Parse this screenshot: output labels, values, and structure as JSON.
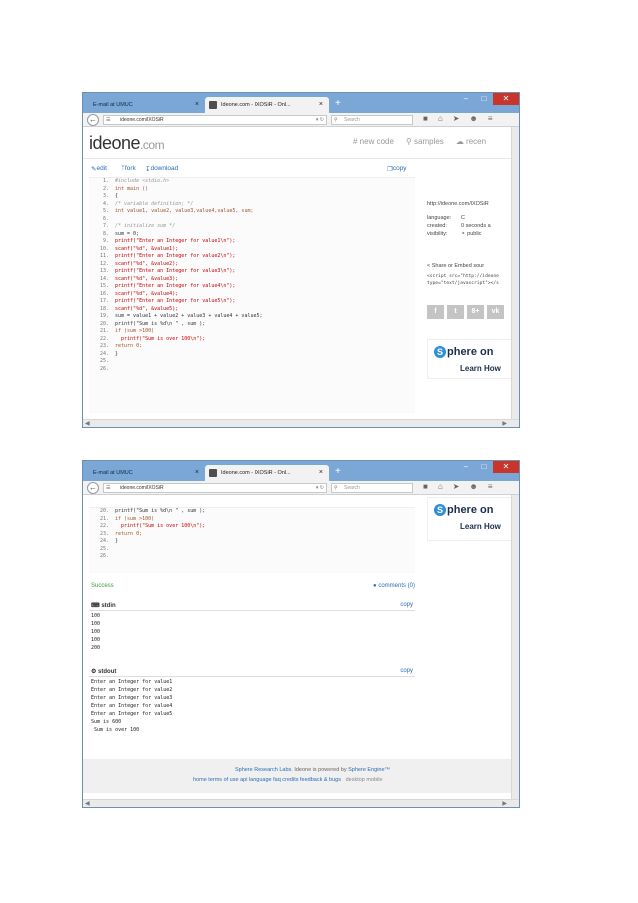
{
  "browser": {
    "tab_inactive": "E-mail at UMUC",
    "tab_active": "Ideone.com - lXOSiR - Onl...",
    "tab_close": "×",
    "new_tab": "+",
    "url": "ideone.com/lXOSiR",
    "search_placeholder": "Search",
    "min": "–",
    "max": "□",
    "close": "✕"
  },
  "ideone": {
    "logo_main": "ideone",
    "logo_com": ".com",
    "nav_new_code": "new code",
    "nav_samples": "samples",
    "nav_recent": "recen",
    "edit": "edit",
    "fork": "fork",
    "download": "download",
    "copy": "copy"
  },
  "code_full": [
    {
      "n": "1.",
      "t": "#include <stdio.h>",
      "c": "cm"
    },
    {
      "n": "2.",
      "t": "int main ()",
      "c": "kw"
    },
    {
      "n": "3.",
      "t": "{",
      "c": "pl"
    },
    {
      "n": "4.",
      "t": "/* variable definition; */",
      "c": "cm"
    },
    {
      "n": "5.",
      "t": "int value1, value2, value3,value4,value5, sum;",
      "c": "kw"
    },
    {
      "n": "6.",
      "t": "",
      "c": "pl"
    },
    {
      "n": "7.",
      "t": "/* initialize sum */",
      "c": "cm"
    },
    {
      "n": "8.",
      "t": "sum = 0;",
      "c": "pl"
    },
    {
      "n": "9.",
      "t": "printf(\"Enter an Integer for value1\\n\");",
      "c": "st"
    },
    {
      "n": "10.",
      "t": "scanf(\"%d\", &value1);",
      "c": "st"
    },
    {
      "n": "11.",
      "t": "printf(\"Enter an Integer for value2\\n\");",
      "c": "st"
    },
    {
      "n": "12.",
      "t": "scanf(\"%d\", &value2);",
      "c": "st"
    },
    {
      "n": "13.",
      "t": "printf(\"Enter an Integer for value3\\n\");",
      "c": "st"
    },
    {
      "n": "14.",
      "t": "scanf(\"%d\", &value3);",
      "c": "st"
    },
    {
      "n": "15.",
      "t": "printf(\"Enter an Integer for value4\\n\");",
      "c": "st"
    },
    {
      "n": "16.",
      "t": "scanf(\"%d\", &value4);",
      "c": "st"
    },
    {
      "n": "17.",
      "t": "printf(\"Enter an Integer for value5\\n\");",
      "c": "st"
    },
    {
      "n": "18.",
      "t": "scanf(\"%d\", &value5);",
      "c": "st"
    },
    {
      "n": "19.",
      "t": "sum = value1 + value2 + value3 + value4 + value5;",
      "c": "pl"
    },
    {
      "n": "20.",
      "t": "printf(\"Sum is %d\\n \" , sum );",
      "c": "pl"
    },
    {
      "n": "21.",
      "t": "if (sum >100)",
      "c": "kw"
    },
    {
      "n": "22.",
      "t": "  printf(\"Sum is over 100\\n\");",
      "c": "st"
    },
    {
      "n": "23.",
      "t": "return 0;",
      "c": "kw"
    },
    {
      "n": "24.",
      "t": "}",
      "c": "pl"
    },
    {
      "n": "25.",
      "t": "",
      "c": "pl"
    },
    {
      "n": "26.",
      "t": "",
      "c": "pl"
    }
  ],
  "code_tail": [
    {
      "n": "20.",
      "t": "printf(\"Sum is %d\\n \" , sum );",
      "c": "pl"
    },
    {
      "n": "21.",
      "t": "if (sum >100)",
      "c": "kw"
    },
    {
      "n": "22.",
      "t": "  printf(\"Sum is over 100\\n\");",
      "c": "st"
    },
    {
      "n": "23.",
      "t": "return 0;",
      "c": "kw"
    },
    {
      "n": "24.",
      "t": "}",
      "c": "pl"
    },
    {
      "n": "25.",
      "t": "",
      "c": "pl"
    },
    {
      "n": "26.",
      "t": "",
      "c": "pl"
    }
  ],
  "sidebar": {
    "url": "http://ideone.com/lXOSiR",
    "language_k": "language:",
    "language_v": "C",
    "created_k": "created:",
    "created_v": "0 seconds a",
    "visibility_k": "visibility:",
    "visibility_v": "public",
    "share": "Share or Embed sour",
    "embed1": "<script src=\"http://ideone",
    "embed2": "type=\"text/javascript\"></s",
    "social_f": "f",
    "social_t": "t",
    "social_g": "8+",
    "social_vk": "vk"
  },
  "ad": {
    "s": "S",
    "sphere": "phere on",
    "learn": "Learn How"
  },
  "results": {
    "success": "Success",
    "comments": "comments (0)",
    "stdin_title": "stdin",
    "stdin_copy": "copy",
    "stdin": "100\n100\n100\n100\n200",
    "stdout_title": "stdout",
    "stdout_copy": "copy",
    "stdout": "Enter an Integer for value1\nEnter an Integer for value2\nEnter an Integer for value3\nEnter an Integer for value4\nEnter an Integer for value5\nSum is 600\n Sum is over 100"
  },
  "footer": {
    "sphere_labs": "Sphere Research Labs",
    "powered": ". Ideone is powered by ",
    "engine": "Sphere Engine™",
    "links": "home  terms of use  api  language  faq  credits  feedback & bugs",
    "desktop": "desktop  mobile"
  }
}
